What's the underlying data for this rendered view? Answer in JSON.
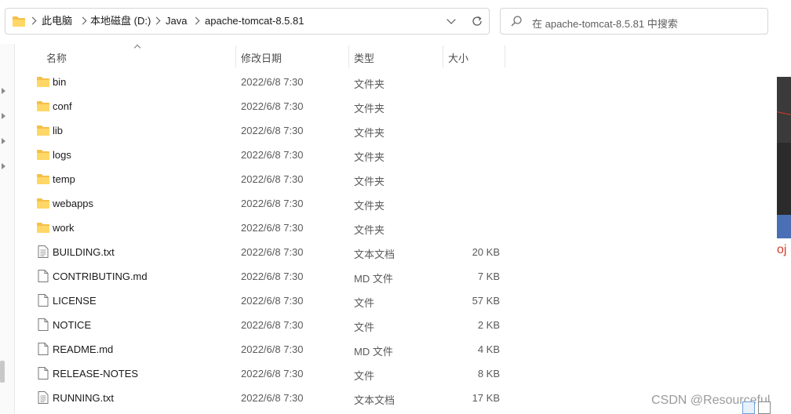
{
  "address_bar": {
    "breadcrumbs": [
      "此电脑",
      "本地磁盘 (D:)",
      "Java",
      "apache-tomcat-8.5.81"
    ]
  },
  "search": {
    "placeholder": "在 apache-tomcat-8.5.81 中搜索"
  },
  "columns": {
    "name": "名称",
    "date": "修改日期",
    "type": "类型",
    "size": "大小"
  },
  "files": [
    {
      "name": "bin",
      "date": "2022/6/8 7:30",
      "type": "文件夹",
      "size": "",
      "icon": "folder-icon"
    },
    {
      "name": "conf",
      "date": "2022/6/8 7:30",
      "type": "文件夹",
      "size": "",
      "icon": "folder-icon"
    },
    {
      "name": "lib",
      "date": "2022/6/8 7:30",
      "type": "文件夹",
      "size": "",
      "icon": "folder-icon"
    },
    {
      "name": "logs",
      "date": "2022/6/8 7:30",
      "type": "文件夹",
      "size": "",
      "icon": "folder-icon"
    },
    {
      "name": "temp",
      "date": "2022/6/8 7:30",
      "type": "文件夹",
      "size": "",
      "icon": "folder-icon"
    },
    {
      "name": "webapps",
      "date": "2022/6/8 7:30",
      "type": "文件夹",
      "size": "",
      "icon": "folder-icon"
    },
    {
      "name": "work",
      "date": "2022/6/8 7:30",
      "type": "文件夹",
      "size": "",
      "icon": "folder-icon"
    },
    {
      "name": "BUILDING.txt",
      "date": "2022/6/8 7:30",
      "type": "文本文档",
      "size": "20 KB",
      "icon": "text-file-icon"
    },
    {
      "name": "CONTRIBUTING.md",
      "date": "2022/6/8 7:30",
      "type": "MD 文件",
      "size": "7 KB",
      "icon": "file-icon"
    },
    {
      "name": "LICENSE",
      "date": "2022/6/8 7:30",
      "type": "文件",
      "size": "57 KB",
      "icon": "file-icon"
    },
    {
      "name": "NOTICE",
      "date": "2022/6/8 7:30",
      "type": "文件",
      "size": "2 KB",
      "icon": "file-icon"
    },
    {
      "name": "README.md",
      "date": "2022/6/8 7:30",
      "type": "MD 文件",
      "size": "4 KB",
      "icon": "file-icon"
    },
    {
      "name": "RELEASE-NOTES",
      "date": "2022/6/8 7:30",
      "type": "文件",
      "size": "8 KB",
      "icon": "file-icon"
    },
    {
      "name": "RUNNING.txt",
      "date": "2022/6/8 7:30",
      "type": "文本文档",
      "size": "17 KB",
      "icon": "text-file-icon"
    }
  ],
  "background_app": {
    "text": "oj"
  },
  "watermark": "CSDN @Resourceful"
}
